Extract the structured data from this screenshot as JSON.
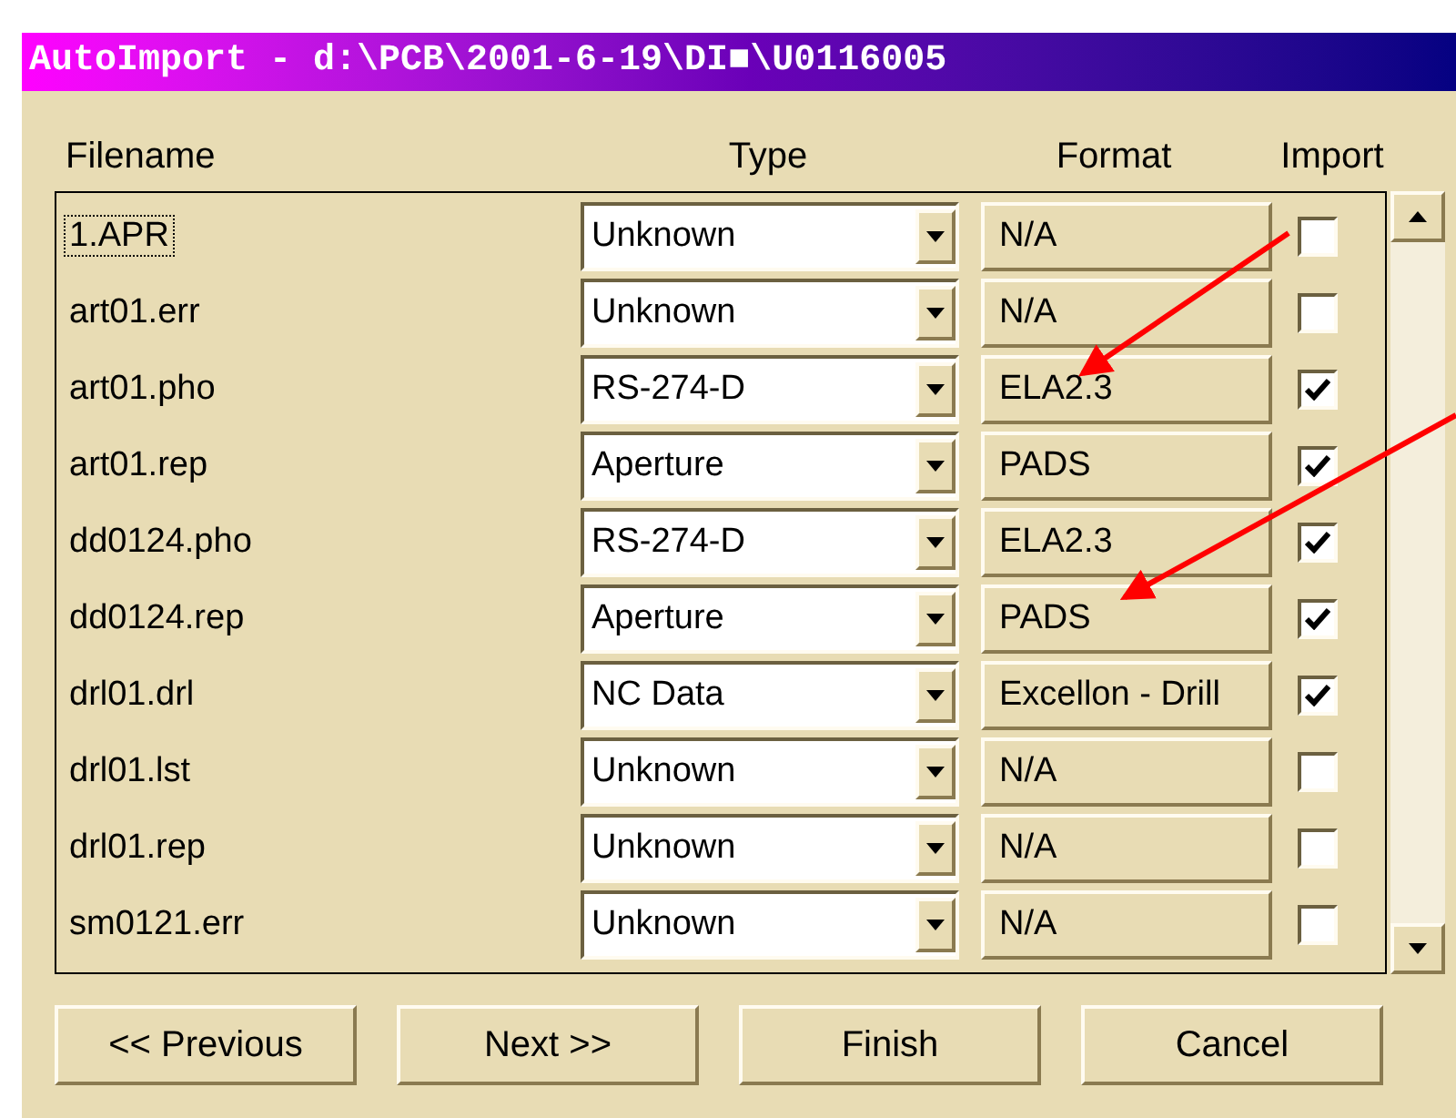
{
  "window": {
    "title": "AutoImport - d:\\PCB\\2001-6-19\\DI■\\U0116005"
  },
  "columns": [
    "Filename",
    "Type",
    "Format",
    "Import"
  ],
  "rows": [
    {
      "filename": "1.APR",
      "type": "Unknown",
      "format": "N/A",
      "checked": false,
      "focused": true
    },
    {
      "filename": "art01.err",
      "type": "Unknown",
      "format": "N/A",
      "checked": false,
      "focused": false
    },
    {
      "filename": "art01.pho",
      "type": "RS-274-D",
      "format": "ELA2.3",
      "checked": true,
      "focused": false
    },
    {
      "filename": "art01.rep",
      "type": "Aperture",
      "format": "PADS",
      "checked": true,
      "focused": false
    },
    {
      "filename": "dd0124.pho",
      "type": "RS-274-D",
      "format": "ELA2.3",
      "checked": true,
      "focused": false
    },
    {
      "filename": "dd0124.rep",
      "type": "Aperture",
      "format": "PADS",
      "checked": true,
      "focused": false
    },
    {
      "filename": "drl01.drl",
      "type": "NC Data",
      "format": "Excellon - Drill",
      "checked": true,
      "focused": false
    },
    {
      "filename": "drl01.lst",
      "type": "Unknown",
      "format": "N/A",
      "checked": false,
      "focused": false
    },
    {
      "filename": "drl01.rep",
      "type": "Unknown",
      "format": "N/A",
      "checked": false,
      "focused": false
    },
    {
      "filename": "sm0121.err",
      "type": "Unknown",
      "format": "N/A",
      "checked": false,
      "focused": false
    }
  ],
  "buttons": [
    "<< Previous",
    "Next >>",
    "Finish",
    "Cancel"
  ]
}
